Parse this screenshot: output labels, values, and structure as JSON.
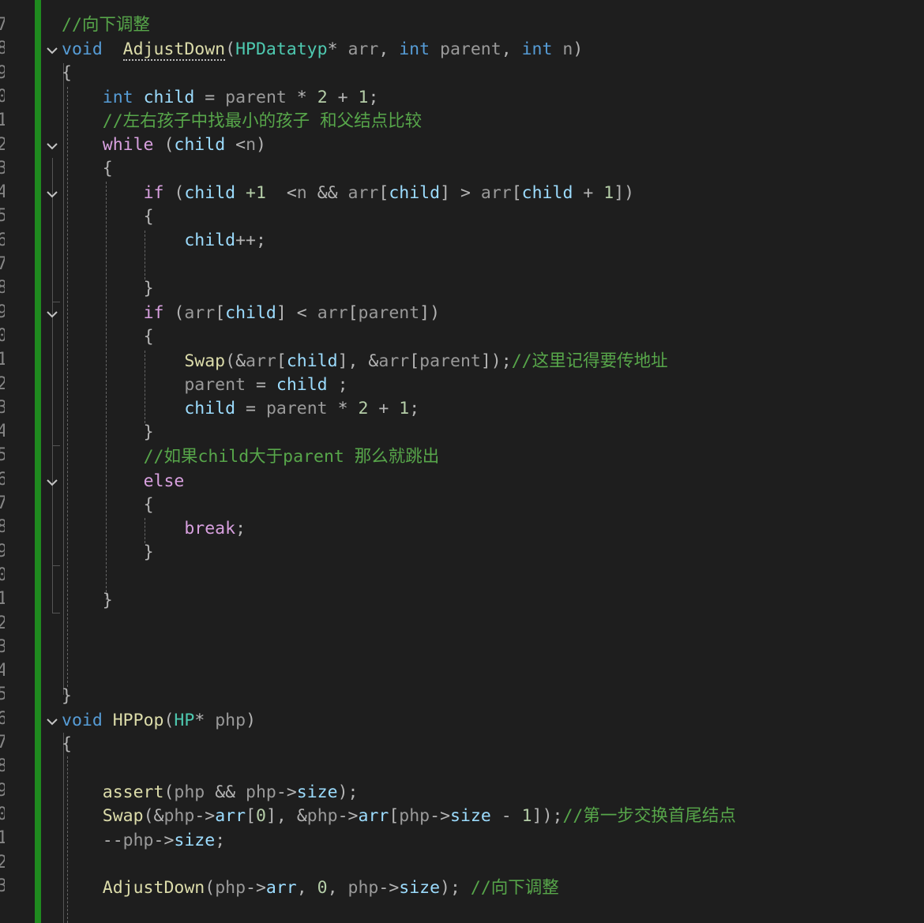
{
  "line_number_fragments": [
    "7",
    "8",
    "9",
    "0",
    "1",
    "2",
    "3",
    "4",
    "5",
    "6",
    "7",
    "8",
    "9",
    "0",
    "1",
    "2",
    "3",
    "4",
    "5",
    "6",
    "7",
    "8",
    "9",
    "0",
    "1",
    "2",
    "3",
    "4",
    "5",
    "6",
    "7",
    "8",
    "9",
    "0",
    "1",
    "2",
    "3"
  ],
  "code": {
    "c1": "//向下调整",
    "kw_void": "void",
    "fn_adjustdown_def": "AdjustDown",
    "ty_hpdatatyp": "HPDatatyp",
    "star": "*",
    "p_arr": "arr",
    "comma": ",",
    "kw_int": "int",
    "p_parent": "parent",
    "p_n": "n",
    "lparen": "(",
    "rparen": ")",
    "lbrace": "{",
    "rbrace": "}",
    "v_child": "child",
    "eq": "=",
    "mul": "*",
    "plus": "+",
    "num_2": "2",
    "num_1": "1",
    "semi": ";",
    "c2": "//左右孩子中找最小的孩子 和父结点比较",
    "kw_while": "while",
    "lt": "<",
    "gt": ">",
    "and": "&&",
    "kw_if": "if",
    "plus1": "+1",
    "lbr": "[",
    "rbr": "]",
    "inc": "++",
    "fn_swap": "Swap",
    "amp": "&",
    "c3": "//这里记得要传地址",
    "c4": "//如果child大于parent 那么就跳出",
    "kw_else": "else",
    "kw_break": "break",
    "fn_hppop": "HPPop",
    "ty_hp": "HP",
    "p_php": "php",
    "fn_assert": "assert",
    "arrow": "->",
    "m_size": "size",
    "m_arr": "arr",
    "num_0": "0",
    "minus": "-",
    "dec": "--",
    "c5": "//第一步交换首尾结点",
    "fn_adjustdown_call": "AdjustDown",
    "c6": "//向下调整"
  },
  "colors": {
    "background": "#1e1e1e",
    "keyword": "#569cd6",
    "control_keyword": "#d8a0df",
    "function": "#dcdcaa",
    "type": "#4ec9b0",
    "variable": "#9cdcfe",
    "parameter": "#9a9a9a",
    "number": "#b5cea8",
    "comment": "#57a64a",
    "change_bar": "#1f8a1f"
  },
  "icons": [
    "chevron-down-icon"
  ]
}
